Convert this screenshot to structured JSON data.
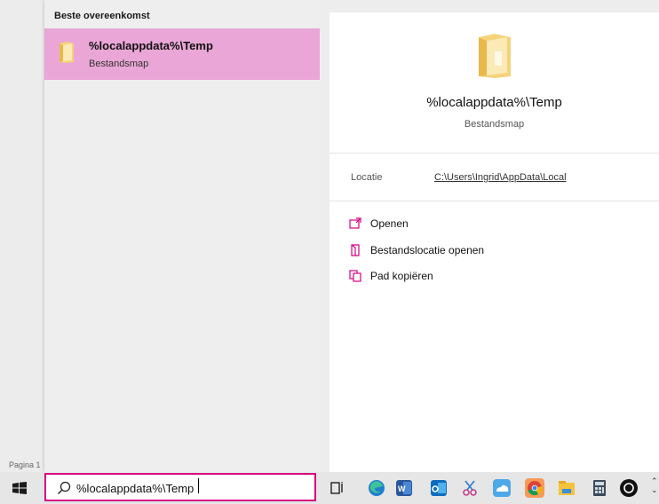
{
  "left_bg": {
    "pagina_label": "Pagina 1"
  },
  "results": {
    "group_title": "Beste overeenkomst",
    "item": {
      "title": "%localappdata%\\Temp",
      "subtitle": "Bestandsmap"
    }
  },
  "detail": {
    "title": "%localappdata%\\Temp",
    "subtitle": "Bestandsmap",
    "location_label": "Locatie",
    "location_value": "C:\\Users\\Ingrid\\AppData\\Local",
    "actions": [
      {
        "label": "Openen",
        "icon": "open-window-icon"
      },
      {
        "label": "Bestandslocatie openen",
        "icon": "file-location-icon"
      },
      {
        "label": "Pad kopiëren",
        "icon": "copy-path-icon"
      }
    ]
  },
  "taskbar": {
    "search_value": "%localappdata%\\Temp",
    "apps": [
      "task-view-icon",
      "edge-icon",
      "word-icon",
      "outlook-icon",
      "snipping-tool-icon",
      "onedrive-icon",
      "chrome-icon",
      "file-explorer-icon",
      "calculator-icon",
      "app-icon"
    ]
  },
  "colors": {
    "accent": "#d5007f",
    "selection": "#e9a6d6"
  }
}
